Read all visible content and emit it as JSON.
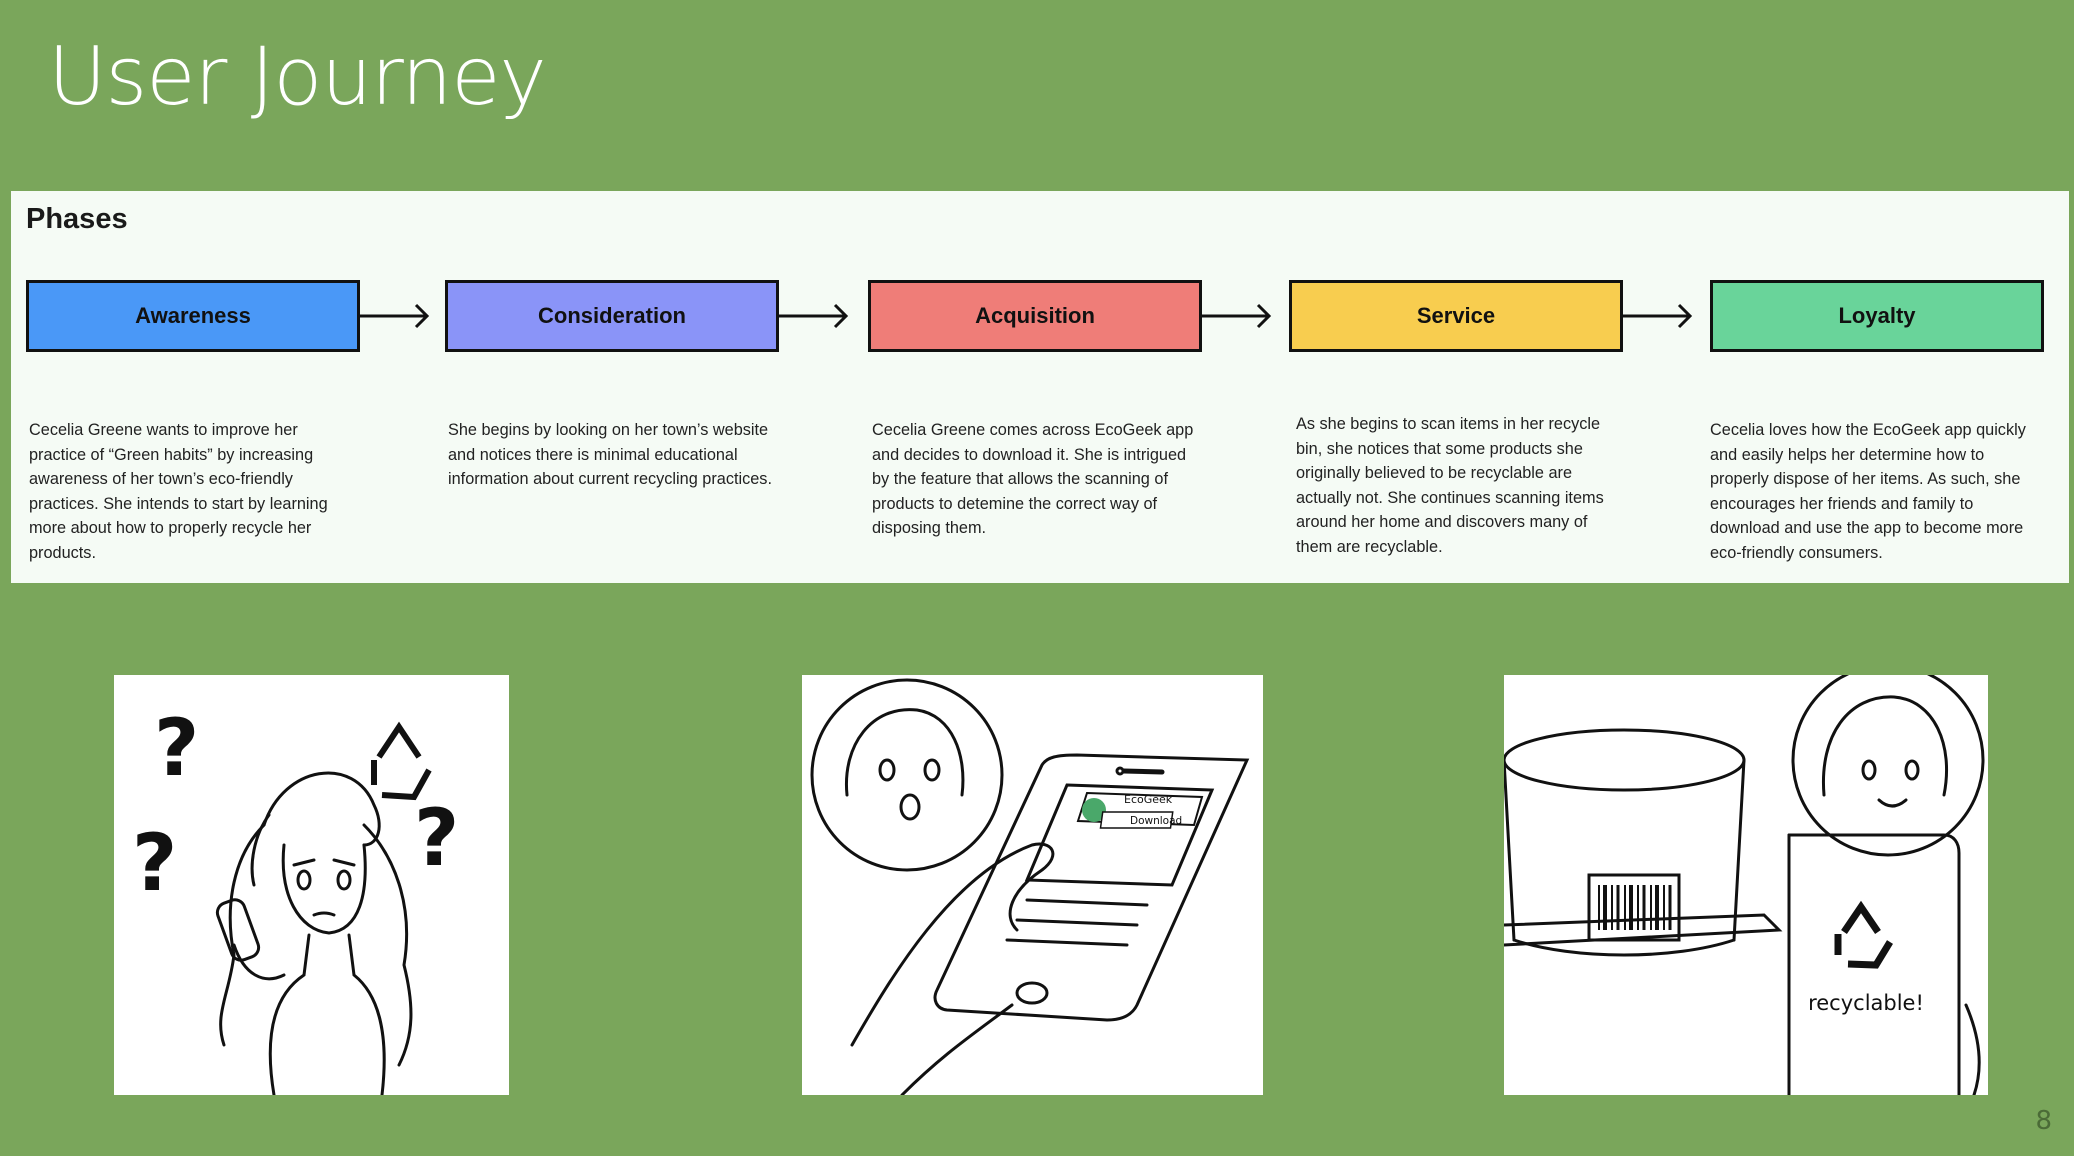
{
  "slide": {
    "title": "User Journey",
    "page_number": "8"
  },
  "phases_panel": {
    "title": "Phases",
    "phases": [
      {
        "label": "Awareness",
        "color": "#4a98f7",
        "description": "Cecelia Greene wants to improve her practice of “Green habits” by increasing awareness of her town’s eco-friendly practices. She intends to start by learning more about how to properly recycle her products."
      },
      {
        "label": "Consideration",
        "color": "#8a94f8",
        "description": "She begins by looking on her town’s website and notices there is minimal educational information about current recycling practices."
      },
      {
        "label": "Acquisition",
        "color": "#ef7d78",
        "description": "Cecelia Greene comes across EcoGeek app and decides to download it. She is intrigued by the feature that allows the scanning of products to detemine the correct way of disposing them."
      },
      {
        "label": "Service",
        "color": "#f8cd4f",
        "description": "As she begins to scan items in her recycle bin, she notices that some products she originally believed to be recyclable are actually not. She continues scanning items around her home and discovers many of them are recyclable."
      },
      {
        "label": "Loyalty",
        "color": "#69d49a",
        "description": "Cecelia loves how the EcoGeek app quickly and easily helps her determine how to properly dispose of her items. As such, she encourages her friends and family to download and use the app to become more eco-friendly consumers."
      }
    ]
  },
  "illustrations": {
    "confused": {
      "marks": [
        "?",
        "?",
        "?"
      ]
    },
    "app_download": {
      "app_name": "EcoGeek",
      "button_label": "Download"
    },
    "scan_result": {
      "result_text": "recyclable!"
    }
  }
}
